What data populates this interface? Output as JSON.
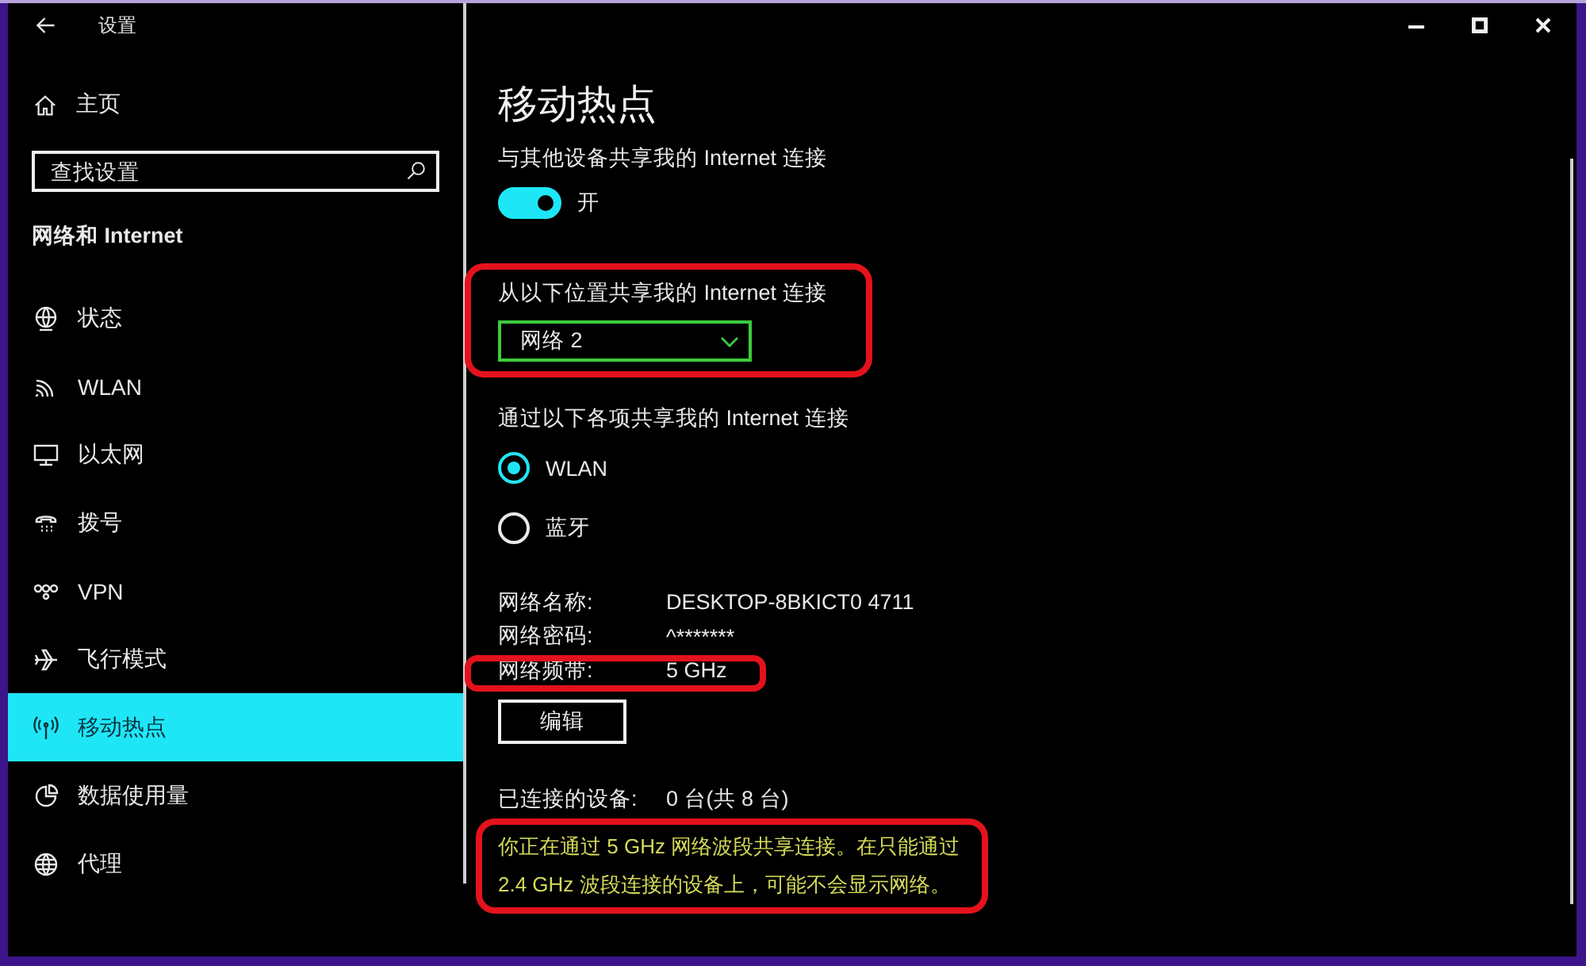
{
  "window": {
    "title": "设置"
  },
  "sidebar": {
    "home": "主页",
    "search": {
      "placeholder": "查找设置"
    },
    "section_title": "网络和 Internet",
    "items": [
      {
        "label": "状态",
        "selected": false
      },
      {
        "label": "WLAN",
        "selected": false
      },
      {
        "label": "以太网",
        "selected": false
      },
      {
        "label": "拨号",
        "selected": false
      },
      {
        "label": "VPN",
        "selected": false
      },
      {
        "label": "飞行模式",
        "selected": false
      },
      {
        "label": "移动热点",
        "selected": true
      },
      {
        "label": "数据使用量",
        "selected": false
      },
      {
        "label": "代理",
        "selected": false
      }
    ]
  },
  "page": {
    "title": "移动热点",
    "share": {
      "label": "与其他设备共享我的 Internet 连接",
      "on": true,
      "state_text": "开"
    },
    "source": {
      "label": "从以下位置共享我的 Internet 连接",
      "value": "网络 2",
      "highlighted": true
    },
    "share_over": {
      "label": "通过以下各项共享我的 Internet 连接",
      "options": [
        {
          "label": "WLAN",
          "selected": true
        },
        {
          "label": "蓝牙",
          "selected": false
        }
      ]
    },
    "properties": [
      {
        "label": "网络名称:",
        "value": "DESKTOP-8BKICT0 4711",
        "highlighted": false
      },
      {
        "label": "网络密码:",
        "value": "^*******",
        "highlighted": false
      },
      {
        "label": "网络频带:",
        "value": "5 GHz",
        "highlighted": true
      }
    ],
    "edit_button": "编辑",
    "connected": {
      "label": "已连接的设备:",
      "value": "0 台(共 8 台)"
    },
    "note": {
      "lines": [
        "你正在通过 5 GHz 网络波段共享连接。在只能通过",
        "2.4 GHz 波段连接的设备上，可能不会显示网络。"
      ],
      "highlighted": true
    }
  }
}
